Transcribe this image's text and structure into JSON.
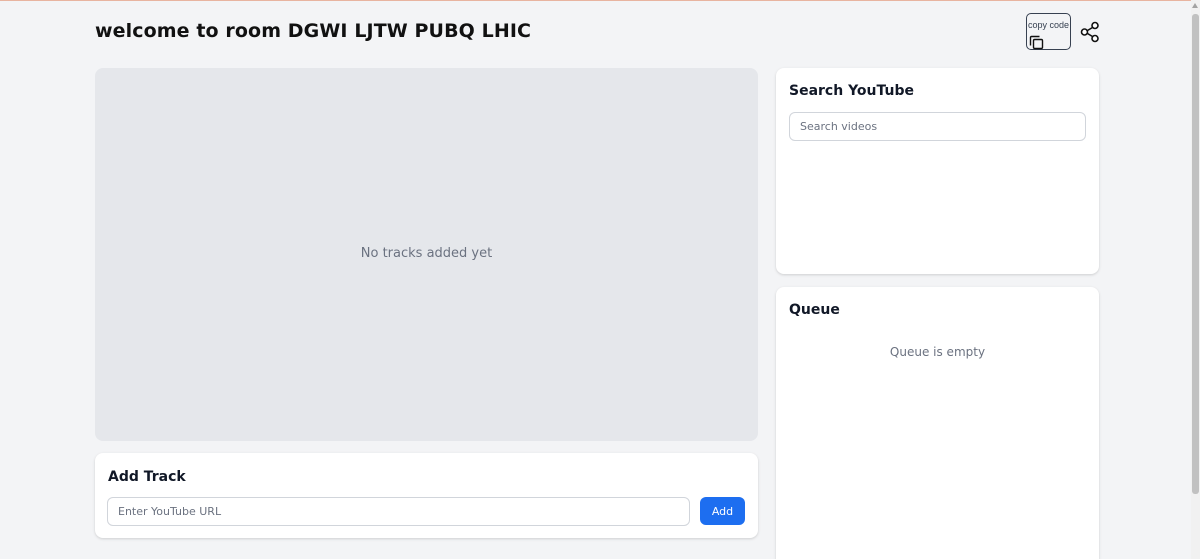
{
  "header": {
    "title": "welcome to room DGWI LJTW PUBQ LHIC",
    "copy_label": "copy code",
    "copy_icon": "copy-icon",
    "share_icon": "share-icon"
  },
  "player": {
    "empty_text": "No tracks added yet"
  },
  "search": {
    "heading": "Search YouTube",
    "placeholder": "Search videos",
    "value": ""
  },
  "queue": {
    "heading": "Queue",
    "empty_text": "Queue is empty"
  },
  "add_track": {
    "heading": "Add Track",
    "placeholder": "Enter YouTube URL",
    "value": "",
    "button_label": "Add"
  },
  "colors": {
    "background": "#f3f4f6",
    "player_bg": "#e5e7eb",
    "card_bg": "#ffffff",
    "accent": "#1d6ef0",
    "muted_text": "#6b7280"
  }
}
